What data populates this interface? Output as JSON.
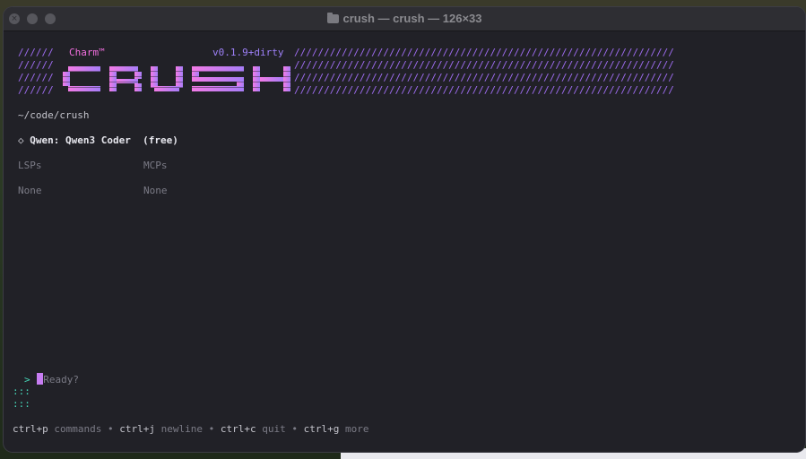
{
  "window": {
    "title": "crush — crush — 126×33"
  },
  "header": {
    "charm_label": "Charm™",
    "version": "v0.1.9+dirty",
    "logo_text": "CRUSH",
    "slash_prefix": "//////",
    "slash_fill": "////////////////////////////////////////////////////////////////"
  },
  "info": {
    "cwd": "~/code/crush",
    "model_bullet": "◇",
    "model_name": "Qwen: Qwen3 Coder",
    "model_tier": "(free)",
    "lsps_label": "LSPs",
    "mcps_label": "MCPs",
    "lsps_value": "None",
    "mcps_value": "None"
  },
  "prompt": {
    "marker": ">",
    "placeholder": "Ready?",
    "continuation": ":::"
  },
  "help": {
    "items": [
      {
        "key": "ctrl+p",
        "desc": "commands"
      },
      {
        "key": "ctrl+j",
        "desc": "newline"
      },
      {
        "key": "ctrl+c",
        "desc": "quit"
      },
      {
        "key": "ctrl+g",
        "desc": "more"
      }
    ],
    "separator": "•"
  },
  "colors": {
    "accent_pink": "#f36fe0",
    "accent_purple": "#9e6cf0",
    "prompt_teal": "#47d6b8",
    "background": "#212127"
  }
}
